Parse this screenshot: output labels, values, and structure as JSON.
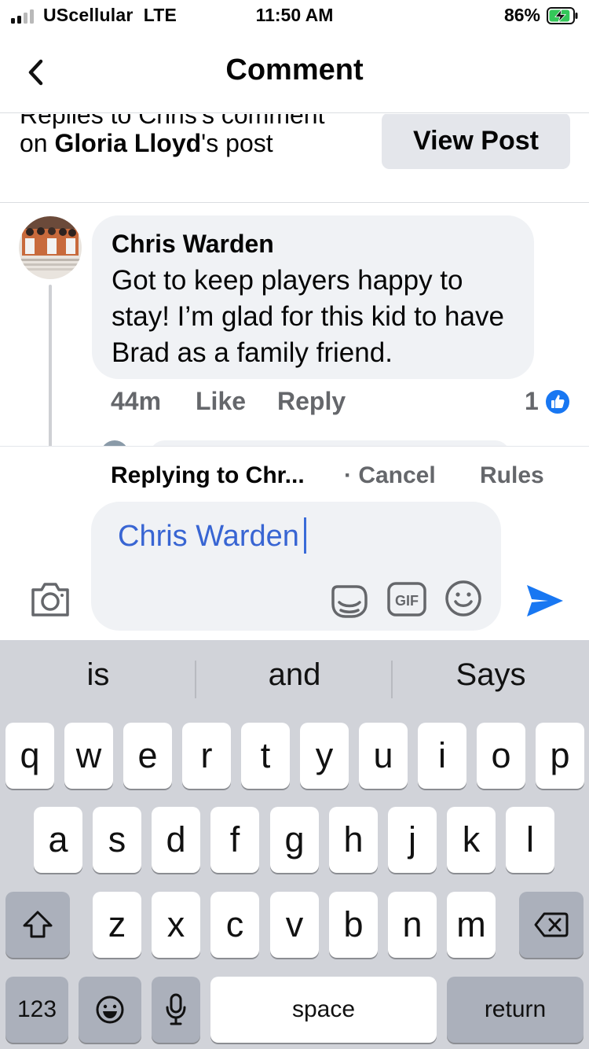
{
  "status_bar": {
    "carrier": "UScellular",
    "network": "LTE",
    "time": "11:50 AM",
    "battery_percent": "86%",
    "battery_level": 0.86,
    "battery_charging": true
  },
  "header": {
    "title": "Comment"
  },
  "context": {
    "line_prefix": "Replies to Chris's comment on",
    "line_name": "Gloria Lloyd",
    "line_suffix": "'s post",
    "view_post_label": "View Post"
  },
  "comment": {
    "author": "Chris Warden",
    "text": "Got to keep players happy to stay! I’m glad for this kid to have Brad as a family friend.",
    "time": "44m",
    "like_label": "Like",
    "reply_label": "Reply",
    "like_count": "1"
  },
  "composer": {
    "replying_to": "Replying to Chr...",
    "cancel_label": "· Cancel",
    "rules_label": "Rules",
    "mention_text": "Chris Warden",
    "gif_label": "GIF"
  },
  "keyboard": {
    "suggestions": [
      "is",
      "and",
      "Says"
    ],
    "row1": [
      "q",
      "w",
      "e",
      "r",
      "t",
      "y",
      "u",
      "i",
      "o",
      "p"
    ],
    "row2": [
      "a",
      "s",
      "d",
      "f",
      "g",
      "h",
      "j",
      "k",
      "l"
    ],
    "row3": [
      "z",
      "x",
      "c",
      "v",
      "b",
      "n",
      "m"
    ],
    "numbers_label": "123",
    "space_label": "space",
    "return_label": "return"
  },
  "colors": {
    "accent_blue": "#1877f2",
    "mention_blue": "#3865d3",
    "bubble_gray": "#f0f2f5",
    "keyboard_bg": "#d1d3d9"
  }
}
